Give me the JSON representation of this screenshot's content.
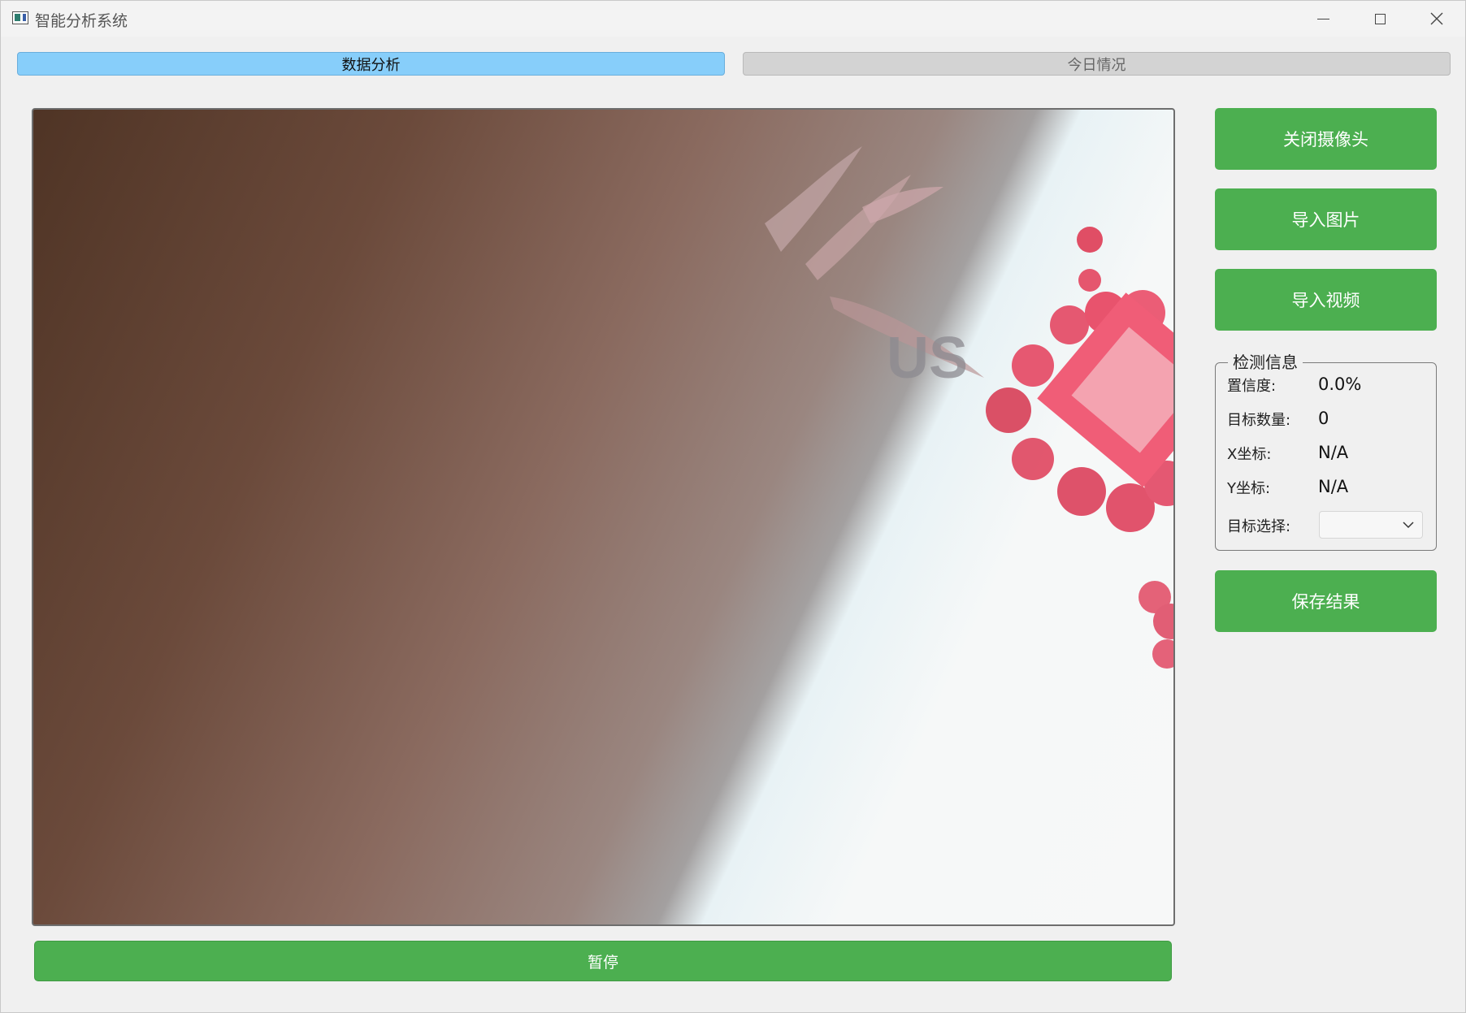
{
  "window": {
    "title": "智能分析系统"
  },
  "tabs": [
    {
      "label": "数据分析",
      "active": true
    },
    {
      "label": "今日情况",
      "active": false
    }
  ],
  "camera": {
    "overlay_text": "US"
  },
  "controls": {
    "pause_label": "暂停",
    "close_camera_label": "关闭摄像头",
    "import_image_label": "导入图片",
    "import_video_label": "导入视频",
    "save_result_label": "保存结果"
  },
  "detection_info": {
    "title": "检测信息",
    "confidence_label": "置信度:",
    "confidence_value": "0.0%",
    "target_count_label": "目标数量:",
    "target_count_value": "0",
    "x_label": "X坐标:",
    "x_value": "N/A",
    "y_label": "Y坐标:",
    "y_value": "N/A",
    "target_select_label": "目标选择:",
    "target_select_value": ""
  },
  "colors": {
    "accent_green": "#4caf50",
    "tab_active": "#87cefa",
    "tab_inactive": "#d3d3d3"
  }
}
